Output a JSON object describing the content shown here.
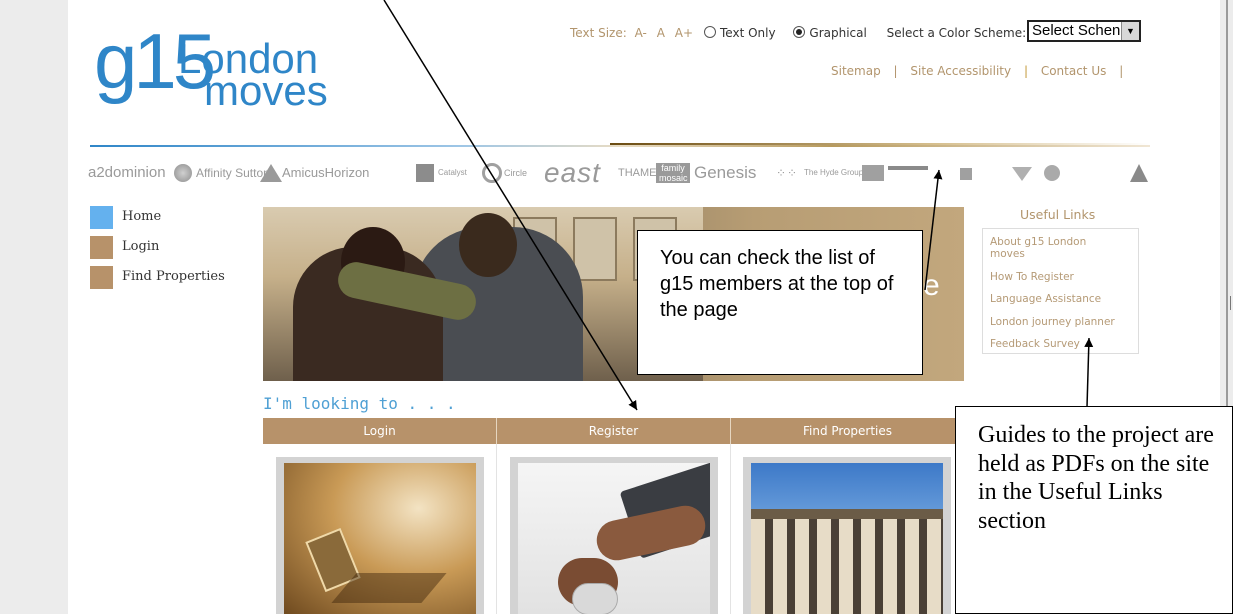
{
  "header": {
    "logo": {
      "g": "g15",
      "line1": "London",
      "line2": "moves"
    },
    "text_size_label": "Text Size:",
    "text_size_options": [
      "A-",
      "A",
      "A+"
    ],
    "text_only_label": "Text Only",
    "graphical_label": "Graphical",
    "color_scheme_label": "Select a Color Scheme:",
    "color_scheme_value": "Select Schen",
    "links": [
      "Sitemap",
      "Site Accessibility",
      "Contact Us"
    ],
    "separator": "|"
  },
  "members": [
    "a2dominion",
    "Affinity Sutton",
    "AmicusHorizon",
    "Catalyst",
    "Circle",
    "east",
    "THAMES",
    "family mosaic",
    "Genesis",
    "The Hyde Group"
  ],
  "nav": {
    "items": [
      {
        "label": "Home",
        "color": "#64b1ee"
      },
      {
        "label": "Login",
        "color": "#b7926a"
      },
      {
        "label": "Find Properties",
        "color": "#b7926a"
      }
    ]
  },
  "hero": {
    "trailing_char": "e"
  },
  "useful_links": {
    "title": "Useful Links",
    "items": [
      "About g15 London moves",
      "How To Register",
      "Language Assistance",
      "London journey planner",
      "Feedback Survey"
    ]
  },
  "main": {
    "heading": "I'm looking to . . .",
    "tabs": [
      "Login",
      "Register",
      "Find Properties"
    ]
  },
  "annotations": {
    "callout1": "You can check the list of g15 members at the top of the page",
    "callout2": "Guides to the project are held as PDFs on the site in the Useful Links section"
  },
  "colors": {
    "accent_blue": "#2f86c8",
    "accent_gold": "#b7926a",
    "text_gold": "#b2956d"
  }
}
